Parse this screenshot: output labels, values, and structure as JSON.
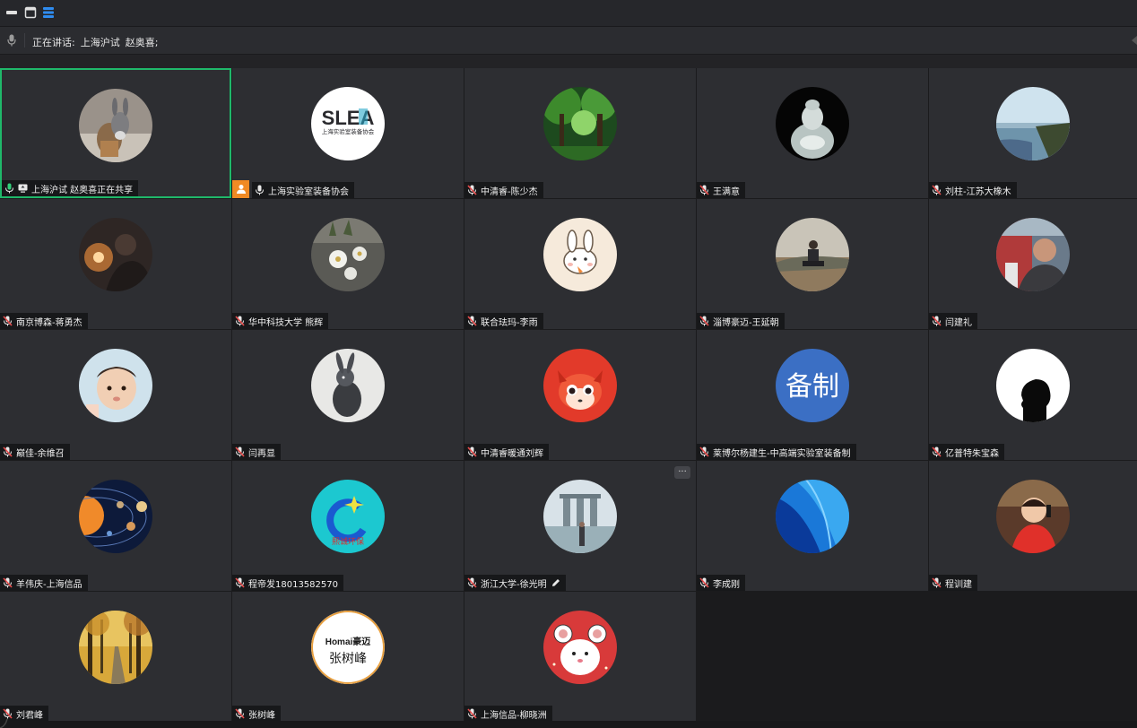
{
  "speaking": {
    "label": "正在讲话:",
    "names": [
      "上海沪试",
      "赵奥喜;"
    ]
  },
  "colors": {
    "active_border": "#1fb86a",
    "host_badge": "#f08a24",
    "tile_bg": "#2d2e32",
    "mic_muted": "#e74c4c"
  },
  "participants": [
    {
      "name": "上海沪试  赵奥喜正在共享",
      "mic": "on",
      "sharing": true,
      "active": true,
      "avatar": "donkey-plush"
    },
    {
      "name": "上海实验室装备协会",
      "mic": "on",
      "host": true,
      "avatar": "slea-logo",
      "avatar_text": "SLEA",
      "avatar_subtext": "上海实验室装备协会"
    },
    {
      "name": "中清睿-陈少杰",
      "mic": "muted",
      "avatar": "forest"
    },
    {
      "name": "王满意",
      "mic": "muted",
      "avatar": "jade-buddha"
    },
    {
      "name": "刘柱-江苏大橡木",
      "mic": "muted",
      "avatar": "coast-cliff"
    },
    {
      "name": "南京博森-蒋勇杰",
      "mic": "muted",
      "avatar": "person-lamp"
    },
    {
      "name": "华中科技大学 熊辉",
      "mic": "muted",
      "avatar": "flowers"
    },
    {
      "name": "联合珐玛-李雨",
      "mic": "muted",
      "avatar": "cartoon-rabbit"
    },
    {
      "name": "淄博豪迈-王延朝",
      "mic": "muted",
      "avatar": "man-sitting-outdoor"
    },
    {
      "name": "闫建礼",
      "mic": "muted",
      "avatar": "man-portrait"
    },
    {
      "name": "巅佳-余维召",
      "mic": "muted",
      "avatar": "baby"
    },
    {
      "name": "闫再显",
      "mic": "muted",
      "avatar": "rabbit-drawing"
    },
    {
      "name": "中清睿暖通刘辉",
      "mic": "muted",
      "avatar": "cartoon-fox"
    },
    {
      "name": "莱博尔杨建生-中高端实验室装备制",
      "mic": "muted",
      "avatar": "text-badge",
      "avatar_text": "备制"
    },
    {
      "name": "亿普特朱宝森",
      "mic": "muted",
      "avatar": "silhouette"
    },
    {
      "name": "羊伟庆-上海信品",
      "mic": "muted",
      "avatar": "solar-system"
    },
    {
      "name": "程帝发18013582570",
      "mic": "muted",
      "avatar": "xicheng-logo",
      "avatar_text": "熙诚环保"
    },
    {
      "name": "浙江大学-徐光明",
      "mic": "muted",
      "avatar": "marina-bay",
      "editing": true,
      "more": true
    },
    {
      "name": "李成刚",
      "mic": "muted",
      "avatar": "blue-abstract"
    },
    {
      "name": "程训建",
      "mic": "muted",
      "avatar": "kid-red"
    },
    {
      "name": "刘君峰",
      "mic": "muted",
      "avatar": "autumn-path"
    },
    {
      "name": "张树峰",
      "mic": "muted",
      "avatar": "homai-logo",
      "avatar_text": "Homai豪迈",
      "avatar_subtext": "张树峰"
    },
    {
      "name": "上海信品-柳晓洲",
      "mic": "muted",
      "avatar": "cartoon-mouse"
    }
  ],
  "more_label": "···"
}
